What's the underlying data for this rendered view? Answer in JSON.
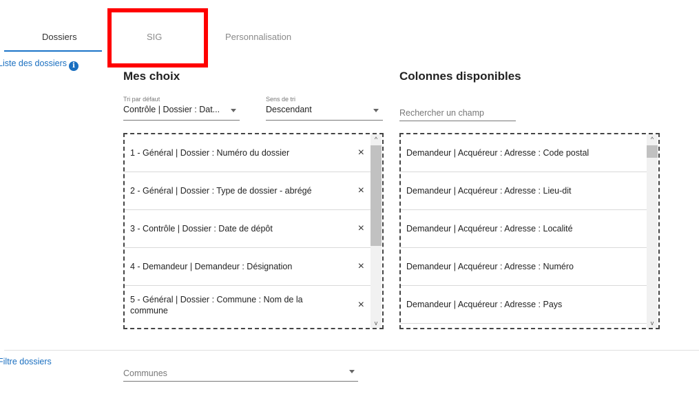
{
  "tabs": [
    {
      "label": "Dossiers"
    },
    {
      "label": "SIG"
    },
    {
      "label": "Personnalisation"
    }
  ],
  "sidebar": {
    "list_label": "Liste des dossiers",
    "info_glyph": "i",
    "filter_label": "Filtre dossiers"
  },
  "mes_choix": {
    "title": "Mes choix",
    "sort_default": {
      "label": "Tri par défaut",
      "value": "Contrôle | Dossier : Dat..."
    },
    "sort_direction": {
      "label": "Sens de tri",
      "value": "Descendant"
    },
    "items": [
      "1 - Général | Dossier : Numéro du dossier",
      "2 - Général | Dossier : Type de dossier - abrégé",
      "3 - Contrôle | Dossier : Date de dépôt",
      "4 - Demandeur | Demandeur : Désignation",
      "5 - Général | Dossier : Commune : Nom de la commune"
    ],
    "remove_glyph": "×"
  },
  "colonnes": {
    "title": "Colonnes disponibles",
    "search_placeholder": "Rechercher un champ",
    "items": [
      "Demandeur | Acquéreur : Adresse : Code postal",
      "Demandeur | Acquéreur : Adresse : Lieu-dit",
      "Demandeur | Acquéreur : Adresse : Localité",
      "Demandeur | Acquéreur : Adresse : Numéro",
      "Demandeur | Acquéreur : Adresse : Pays"
    ]
  },
  "filter": {
    "placeholder": "Communes"
  },
  "scroll_arrows": {
    "up": "^",
    "down": "v"
  },
  "colors": {
    "accent": "#1a73c8",
    "highlight": "#ff0000"
  }
}
